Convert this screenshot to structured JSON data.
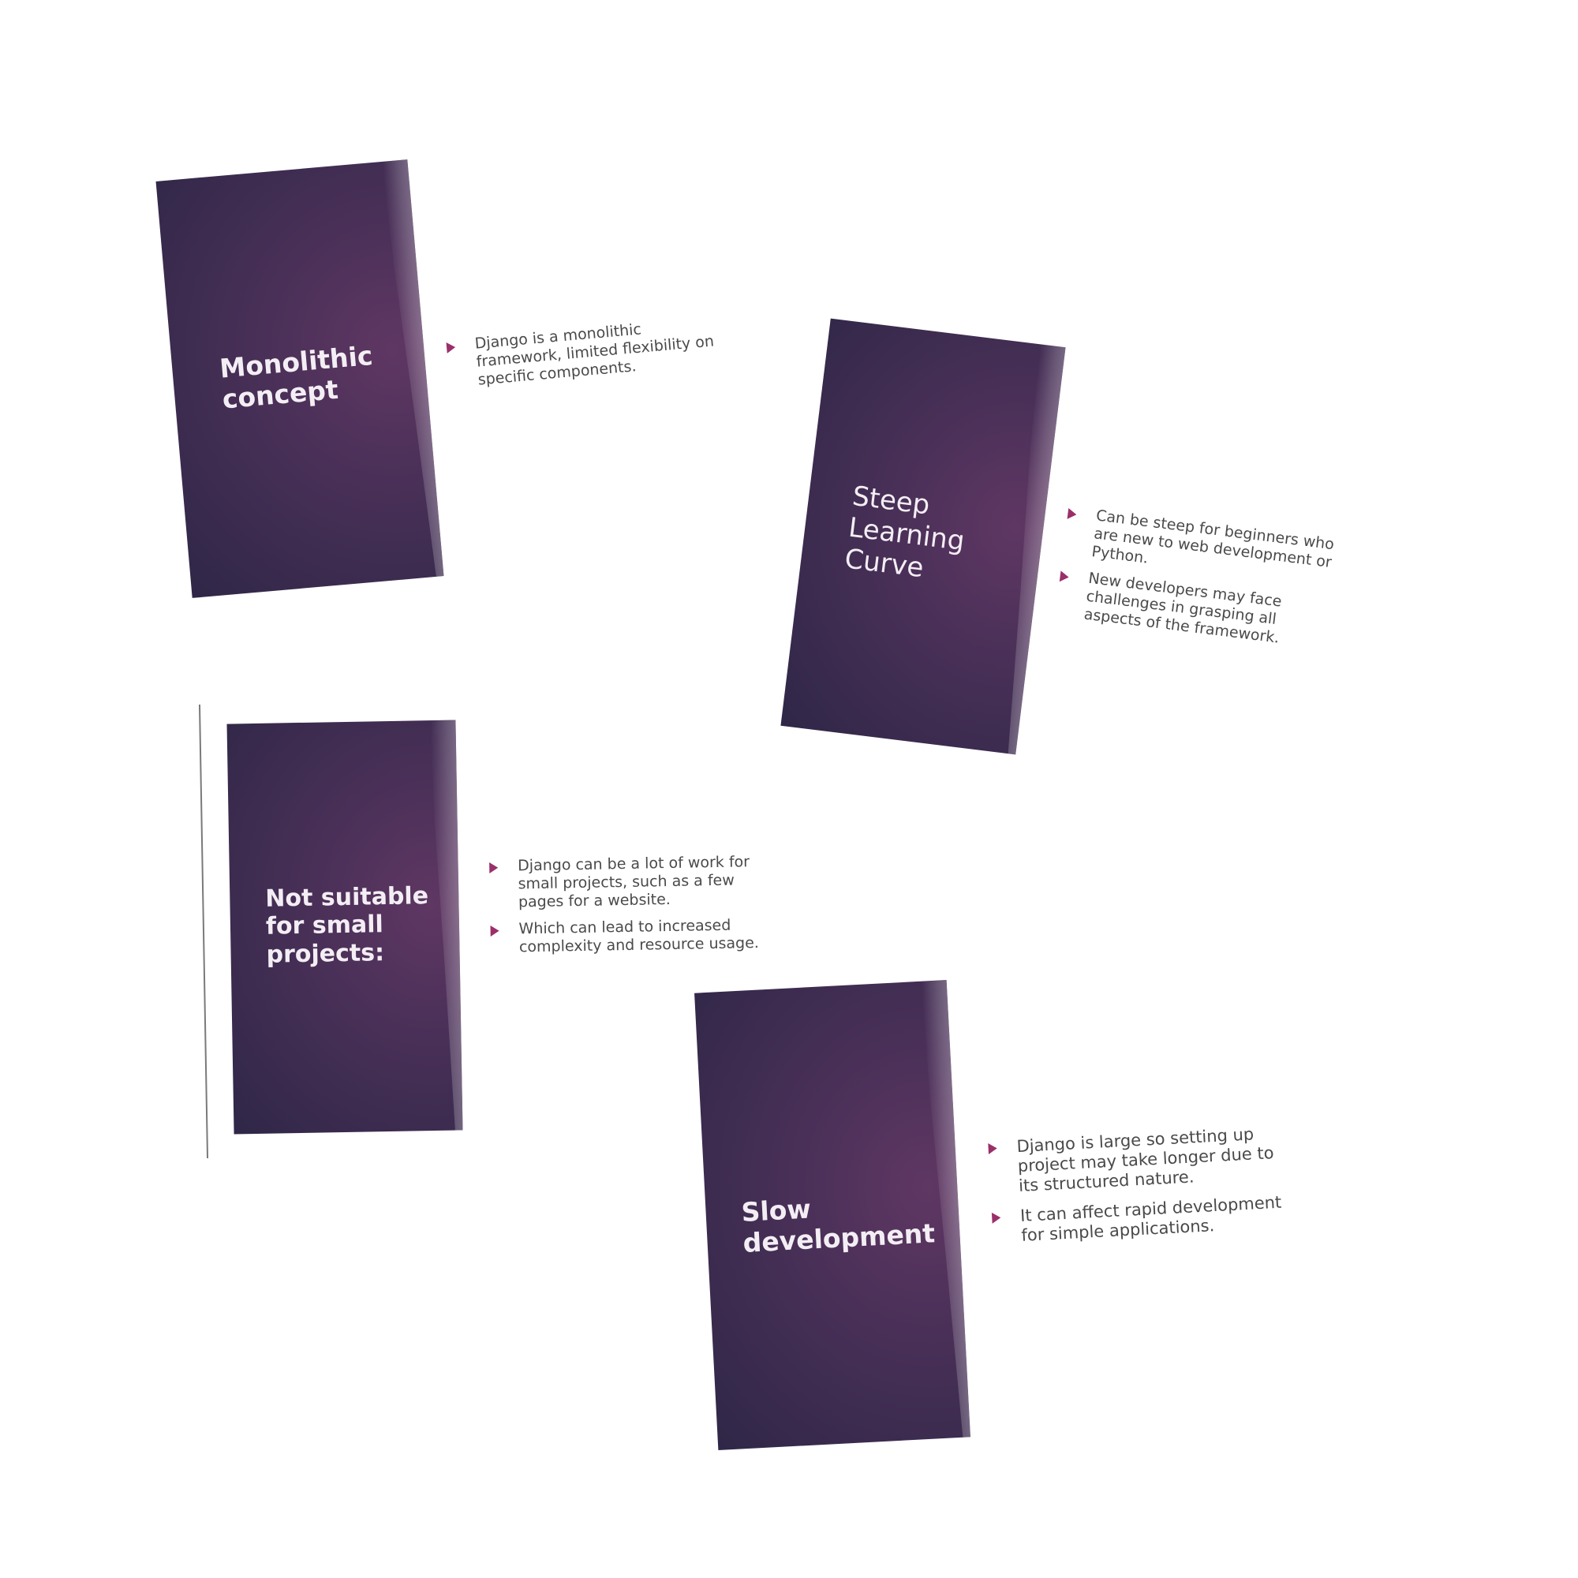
{
  "cards": [
    {
      "title": "Monolithic concept",
      "bullets": [
        "Django is a monolithic framework, limited flexibility on specific components."
      ]
    },
    {
      "title": "Steep Learning Curve",
      "bullets": [
        "Can be steep for beginners who are new to web development or Python.",
        "New developers may face challenges in grasping all aspects of the framework."
      ]
    },
    {
      "title": "Not suitable for small projects:",
      "bullets": [
        "Django can be a lot of work for small projects, such as a few pages for a website.",
        "Which can lead to increased complexity and resource usage."
      ]
    },
    {
      "title": "Slow development",
      "bullets": [
        "Django is large so setting up project may take longer due to its structured nature.",
        "It can affect rapid development for simple applications."
      ]
    }
  ]
}
